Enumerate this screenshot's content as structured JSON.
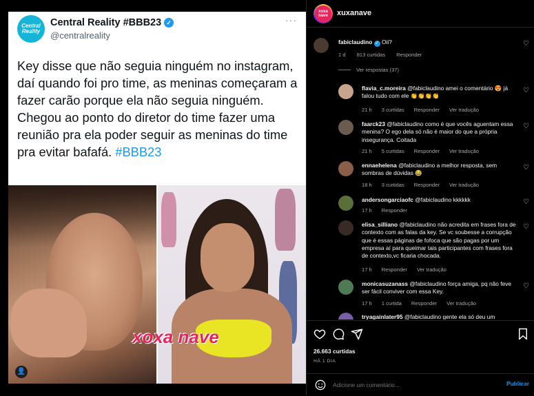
{
  "tweet": {
    "avatar_text": "Central Reality",
    "name": "Central Reality #BBB23",
    "handle": "@centralreality",
    "more": "···",
    "text": "Key disse que não seguia ninguém no instagram, daí quando foi pro time, as meninas começaram a fazer carão porque ela não seguia ninguém. Chegou ao ponto do diretor do time fazer uma reunião pra ela poder seguir as meninas do time pra evitar bafafá. ",
    "hashtag": "#BBB23"
  },
  "media": {
    "watermark": "xoxa nave"
  },
  "post": {
    "account": "xuxanave",
    "avatar_text": "xoxa nave",
    "likes": "26.663 curtidas",
    "date": "HÁ 1 DIA",
    "add_comment_placeholder": "Adicione um comentário...",
    "publish_label": "Publicar"
  },
  "main_comment": {
    "user": "fabiclaudino",
    "text": "Oii?",
    "time": "1 d",
    "likes": "813 curtidas",
    "reply": "Responder",
    "view_replies": "Ver respostas (37)"
  },
  "replies": [
    {
      "user": "flavia_c.moreira",
      "text": "@fabiclaudino amei o comentário 😍 já falou tudo com ele 👏👏👏👏",
      "time": "21 h",
      "likes": "3 curtidas",
      "reply": "Responder",
      "translate": "Ver tradução",
      "color": "#c9a48d"
    },
    {
      "user": "faarck23",
      "text": "@fabiclaudino como é que vocês aguentam essa menina? O ego dela só não é maior do que a própria insegurança. Coitada",
      "time": "21 h",
      "likes": "5 curtidas",
      "reply": "Responder",
      "translate": "Ver tradução",
      "color": "#6b5a4e"
    },
    {
      "user": "ennaehelena",
      "text": "@fabiclaudino a melhor resposta, sem sombras de dúvidas 😂",
      "time": "18 h",
      "likes": "3 curtidas",
      "reply": "Responder",
      "translate": "Ver tradução",
      "color": "#8a5f4a"
    },
    {
      "user": "andersongarciaofc",
      "text": "@fabiclaudino kkkkkk",
      "time": "17 h",
      "likes": "",
      "reply": "Responder",
      "translate": "",
      "color": "#5a6e3a"
    },
    {
      "user": "elisa_silliano",
      "text": "@fabiclaudino não acredita em frases fora de contexto com as falas da key. Se vc soubesse a corrupção que é essas páginas de fofoca que são pagas por um empresa aí para queimar tais participantes com frases fora de contexto,vc ficaria chocada.",
      "time": "17 h",
      "likes": "",
      "reply": "Responder",
      "translate": "Ver tradução",
      "color": "#3a2a25"
    },
    {
      "user": "monicasuzanass",
      "text": "@fabiclaudino força amiga, pq não feve ser fácil conviver com essa Key.",
      "time": "17 h",
      "likes": "1 curtida",
      "reply": "Responder",
      "translate": "Ver tradução",
      "color": "#4f7a56"
    },
    {
      "user": "tryagainlater95",
      "text": "@fabiclaudino gente ela só deu um",
      "time": "",
      "likes": "",
      "reply": "",
      "translate": "",
      "color": "#7b5ea8"
    }
  ]
}
